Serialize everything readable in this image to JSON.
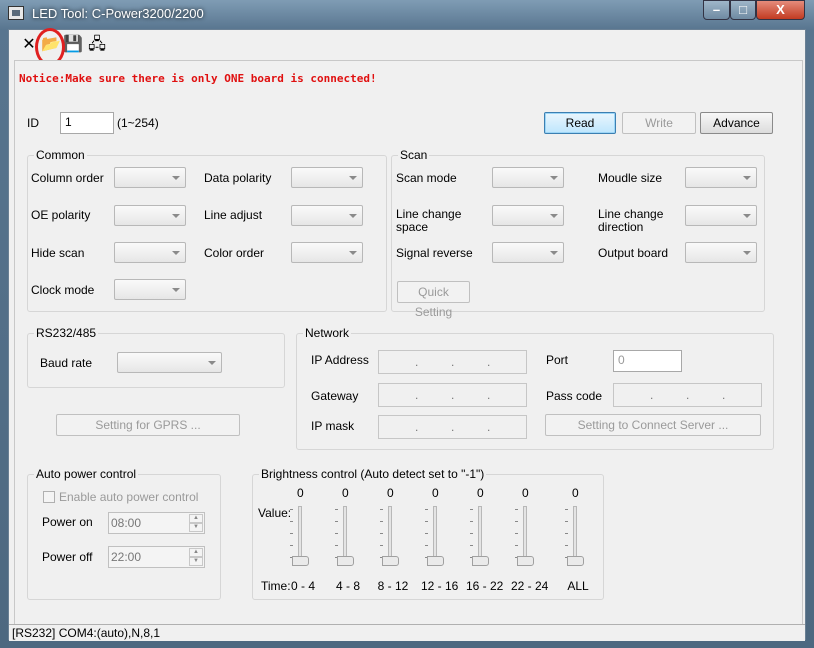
{
  "window": {
    "title": "LED Tool: C-Power3200/2200",
    "min": "–",
    "max": "□",
    "close": "X"
  },
  "toolbar": {
    "close_glyph": "✕",
    "open_glyph": "📂",
    "save_glyph": "💾",
    "connect_glyph": "🖧"
  },
  "notice": "Notice:Make sure there is only ONE board is connected!",
  "id_row": {
    "label": "ID",
    "value": "1",
    "range": "(1~254)"
  },
  "buttons": {
    "read": "Read",
    "write": "Write",
    "advance": "Advance"
  },
  "common": {
    "title": "Common",
    "column_order": "Column order",
    "data_polarity": "Data polarity",
    "oe_polarity": "OE polarity",
    "line_adjust": "Line adjust",
    "hide_scan": "Hide scan",
    "color_order": "Color order",
    "clock_mode": "Clock mode"
  },
  "scan": {
    "title": "Scan",
    "scan_mode": "Scan mode",
    "module_size": "Moudle size",
    "line_change_space": "Line change space",
    "line_change_direction": "Line change direction",
    "signal_reverse": "Signal reverse",
    "output_board": "Output board",
    "quick_setting": "Quick Setting"
  },
  "rs232": {
    "title": "RS232/485",
    "baud_rate": "Baud rate",
    "gprs_button": "Setting for GPRS ..."
  },
  "network": {
    "title": "Network",
    "ip_address": "IP Address",
    "port": "Port",
    "port_value": "0",
    "gateway": "Gateway",
    "pass_code": "Pass code",
    "ip_mask": "IP mask",
    "connect_button": "Setting to Connect Server ...",
    "dot": "."
  },
  "auto_power": {
    "title": "Auto power control",
    "enable": "Enable auto power control",
    "power_on": "Power on",
    "power_on_value": "08:00",
    "power_off": "Power off",
    "power_off_value": "22:00",
    "up": "▲",
    "down": "▼"
  },
  "brightness": {
    "title": "Brightness control (Auto detect set to \"-1\")",
    "value_label": "Value:",
    "time_label": "Time:",
    "sliders": [
      {
        "value": "0",
        "time": "0 - 4"
      },
      {
        "value": "0",
        "time": "4 - 8"
      },
      {
        "value": "0",
        "time": "8 - 12"
      },
      {
        "value": "0",
        "time": "12 - 16"
      },
      {
        "value": "0",
        "time": "16 - 22"
      },
      {
        "value": "0",
        "time": "22 - 24"
      },
      {
        "value": "0",
        "time": "ALL"
      }
    ]
  },
  "status_bar": "[RS232] COM4:(auto),N,8,1"
}
